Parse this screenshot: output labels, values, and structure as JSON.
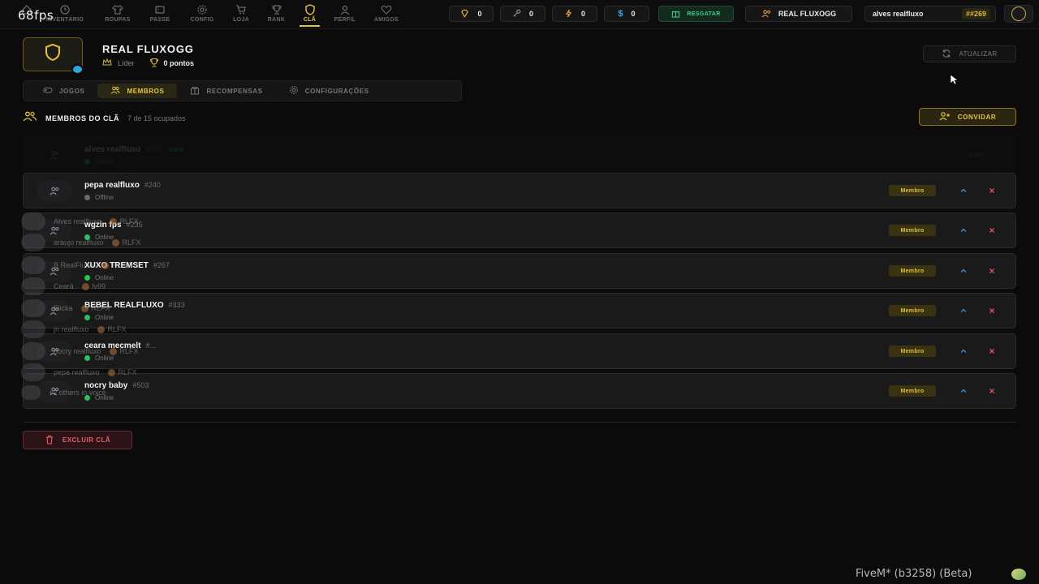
{
  "fps": "68fps",
  "nav": {
    "items": [
      {
        "label": "",
        "icon": "home-icon"
      },
      {
        "label": "INVENTÁRIO",
        "icon": "clock-icon"
      },
      {
        "label": "ROUPAS",
        "icon": "shirt-icon"
      },
      {
        "label": "PASSE",
        "icon": "ticket-icon"
      },
      {
        "label": "CONFIG",
        "icon": "gear-icon"
      },
      {
        "label": "LOJA",
        "icon": "cart-icon"
      },
      {
        "label": "RANK",
        "icon": "trophy-icon"
      },
      {
        "label": "CLÃ",
        "icon": "shield-icon",
        "active": true
      },
      {
        "label": "PERFIL",
        "icon": "user-icon"
      },
      {
        "label": "AMIGOS",
        "icon": "heart-icon"
      }
    ]
  },
  "currencies": [
    {
      "icon": "diamond-icon",
      "value": "0",
      "color": "#e9c532"
    },
    {
      "icon": "key-icon",
      "value": "0",
      "color": "#9a9a9e"
    },
    {
      "icon": "bolt-icon",
      "value": "0",
      "color": "#f0a030"
    },
    {
      "icon": "dollar-icon",
      "value": "0",
      "color": "#3aa7e8"
    }
  ],
  "resgatar_label": "RESGATAR",
  "clan_pill": "REAL FLUXOGG",
  "user": {
    "name": "alves realfluxo",
    "tag": "##269"
  },
  "clan": {
    "name": "REAL FLUXOGG",
    "role": "Líder",
    "points": "0 pontos"
  },
  "atualizar_label": "ATUALIZAR",
  "tabs": [
    {
      "label": "JOGOS",
      "icon": "gamepad-icon"
    },
    {
      "label": "MEMBROS",
      "icon": "users-icon",
      "active": true
    },
    {
      "label": "RECOMPENSAS",
      "icon": "gift-icon"
    },
    {
      "label": "CONFIGURAÇÕES",
      "icon": "gear-icon"
    }
  ],
  "members_header": {
    "title": "MEMBROS DO CLÃ",
    "count": "7 de 15 ocupados"
  },
  "convidar_label": "CONVIDAR",
  "members": [
    {
      "name": "alves realfluxo",
      "id": "#269",
      "you": "Você",
      "status": "Online",
      "online": true,
      "role": "Líder"
    },
    {
      "name": "pepa realfluxo",
      "id": "#240",
      "status": "Offline",
      "online": false,
      "role": "Membro"
    },
    {
      "name": "wgzin fps",
      "id": "#235",
      "status": "Online",
      "online": true,
      "role": "Membro"
    },
    {
      "name": "XUXO TREMSET",
      "id": "#267",
      "status": "Online",
      "online": true,
      "role": "Membro"
    },
    {
      "name": "BEBEL REALFLUXO",
      "id": "#333",
      "status": "Online",
      "online": true,
      "role": "Membro"
    },
    {
      "name": "ceara mecmelt",
      "id": "#...",
      "status": "Online",
      "online": true,
      "role": "Membro"
    },
    {
      "name": "nocry baby",
      "id": "#503",
      "status": "Online",
      "online": true,
      "role": "Membro"
    }
  ],
  "voice_overlay": [
    {
      "name": "Alves realfluxo",
      "clan": "RLFX"
    },
    {
      "name": "araujo realfluxo",
      "clan": "RLFX"
    },
    {
      "name": "B RealFluxo",
      "clan": "RLFX"
    },
    {
      "name": "Ceará",
      "clan": "lv99"
    },
    {
      "name": "Flicka",
      "clan": "RLFX"
    },
    {
      "name": "jn realfluxo",
      "clan": "RLFX"
    },
    {
      "name": "nocry realfluxo",
      "clan": "RLFX"
    },
    {
      "name": "pepa realfluxo",
      "clan": "RLFX"
    },
    {
      "name": "+2 others in voice",
      "clan": ""
    }
  ],
  "excluir_label": "EXCLUIR CLÃ",
  "fivem_label": "FiveM* (b3258) (Beta)"
}
